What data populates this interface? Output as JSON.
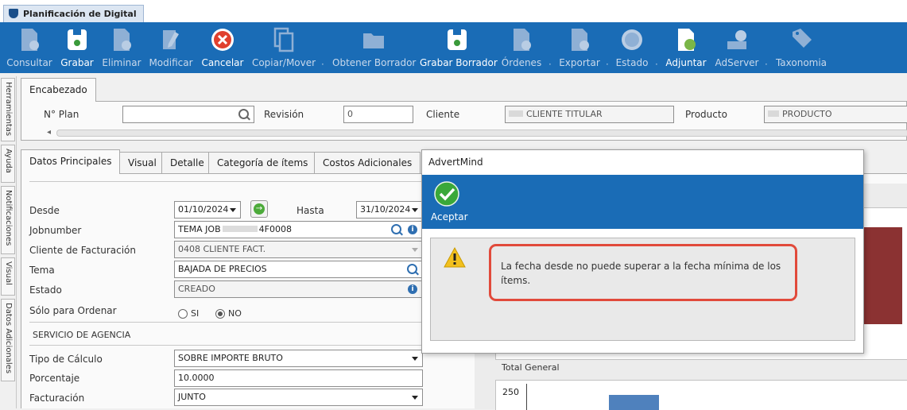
{
  "window": {
    "tab_title": "Planificación de Digital"
  },
  "toolbar": {
    "buttons": [
      {
        "label": "Consultar",
        "icon": "doc-gear-icon"
      },
      {
        "label": "Grabar",
        "icon": "save-icon"
      },
      {
        "label": "Eliminar",
        "icon": "doc-delete-icon"
      },
      {
        "label": "Modificar",
        "icon": "edit-icon"
      },
      {
        "label": "Cancelar",
        "icon": "cancel-icon"
      },
      {
        "label": "Copiar/Mover",
        "icon": "copy-icon"
      },
      {
        "label": "Obtener Borrador",
        "icon": "folder-icon"
      },
      {
        "label": "Grabar Borrador",
        "icon": "save-draft-icon"
      },
      {
        "label": "Órdenes",
        "icon": "orders-icon"
      },
      {
        "label": "Exportar",
        "icon": "export-icon"
      },
      {
        "label": "Estado",
        "icon": "status-icon"
      },
      {
        "label": "Adjuntar",
        "icon": "attach-icon"
      },
      {
        "label": "AdServer",
        "icon": "adserver-icon"
      },
      {
        "label": "Taxonomia",
        "icon": "tag-icon"
      }
    ]
  },
  "side_tabs": [
    "Herramientas",
    "Ayuda",
    "Notificaciones",
    "Visual",
    "Datos Adicionales"
  ],
  "header": {
    "tab": "Encabezado",
    "plan_label": "N° Plan",
    "plan_value": "",
    "revision_label": "Revisión",
    "revision_value": "0",
    "cliente_label": "Cliente",
    "cliente_value": "CLIENTE TITULAR",
    "producto_label": "Producto",
    "producto_value": "PRODUCTO",
    "scroll_arrow": "◂"
  },
  "main_tabs": [
    "Datos Principales",
    "Visual",
    "Detalle",
    "Categoría de ítems",
    "Costos Adicionales"
  ],
  "form": {
    "desde_label": "Desde",
    "desde_value": "01/10/2024",
    "hasta_label": "Hasta",
    "hasta_value": "31/10/2024",
    "jobnumber_label": "Jobnumber",
    "jobnumber_value_a": "TEMA JOB",
    "jobnumber_value_b": "4F0008",
    "cliente_fact_label": "Cliente de Facturación",
    "cliente_fact_value": "0408 CLIENTE FACT.",
    "tema_label": "Tema",
    "tema_value": "BAJADA DE PRECIOS",
    "estado_label": "Estado",
    "estado_value": "CREADO",
    "solo_label": "Sólo para Ordenar",
    "radio_si": "SI",
    "radio_no": "NO",
    "section_label": "SERVICIO DE AGENCIA",
    "tipo_label": "Tipo de Cálculo",
    "tipo_value": "SOBRE IMPORTE BRUTO",
    "porcentaje_label": "Porcentaje",
    "porcentaje_value": "10.0000",
    "facturacion_label": "Facturación",
    "facturacion_value": "JUNTO"
  },
  "right_panel": {
    "total_label": "Total General",
    "axis_top": "250",
    "bar_color_top": "#8b3232",
    "bar_color_bottom": "#4f81bd"
  },
  "dialog": {
    "title": "AdvertMind",
    "accept_label": "Aceptar",
    "message": "La fecha desde no puede superar a la fecha mínima de los ítems.",
    "highlight_color": "#e14a3b"
  }
}
